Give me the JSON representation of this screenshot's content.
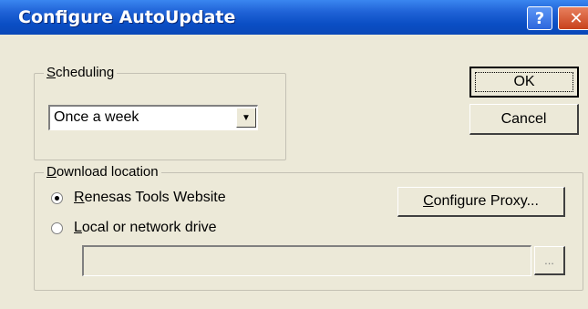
{
  "window": {
    "title": "Configure AutoUpdate"
  },
  "titlebar": {
    "help_label": "?",
    "close_label": "✕"
  },
  "scheduling": {
    "label_accel": "S",
    "label_rest": "cheduling",
    "selected_value": "Once a week",
    "dropdown_arrow": "▼"
  },
  "buttons": {
    "ok": "OK",
    "cancel": "Cancel"
  },
  "download": {
    "label_accel": "D",
    "label_rest": "ownload location",
    "options": [
      {
        "accel": "R",
        "rest": "enesas Tools Website",
        "checked": true
      },
      {
        "accel": "L",
        "rest": "ocal or network drive",
        "checked": false
      }
    ],
    "proxy_accel": "C",
    "proxy_rest": "onfigure Proxy...",
    "path_value": "",
    "browse_label": "..."
  }
}
